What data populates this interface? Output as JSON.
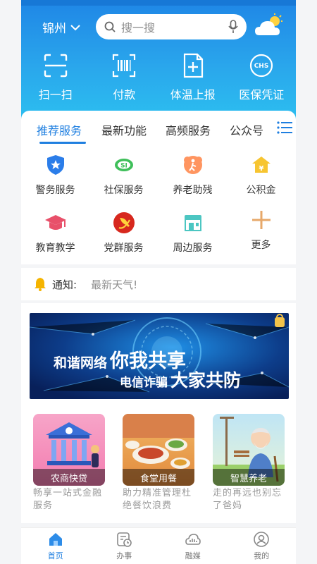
{
  "header": {
    "city": "锦州",
    "search_placeholder": "搜一搜"
  },
  "quick_actions": [
    {
      "label": "扫一扫",
      "icon": "scan-icon"
    },
    {
      "label": "付款",
      "icon": "barcode-icon"
    },
    {
      "label": "体温上报",
      "icon": "health-report-icon"
    },
    {
      "label": "医保凭证",
      "icon": "chs-insurance-icon"
    }
  ],
  "tabs": [
    "推荐服务",
    "最新功能",
    "高频服务",
    "公众号"
  ],
  "services": [
    {
      "label": "警务服务",
      "icon": "police-shield-icon"
    },
    {
      "label": "社保服务",
      "icon": "social-security-icon"
    },
    {
      "label": "养老助残",
      "icon": "elder-care-icon"
    },
    {
      "label": "公积金",
      "icon": "housing-fund-icon"
    },
    {
      "label": "教育教学",
      "icon": "graduation-cap-icon"
    },
    {
      "label": "党群服务",
      "icon": "party-emblem-icon"
    },
    {
      "label": "周边服务",
      "icon": "shop-icon"
    },
    {
      "label": "更多",
      "icon": "plus-icon"
    }
  ],
  "notice": {
    "label": "通知:",
    "message": "最新天气!"
  },
  "banner": {
    "line1": "和谐网络",
    "line1b": "你我共享",
    "line2": "电信诈骗",
    "line2b": "大家共防"
  },
  "features": [
    {
      "title": "农商快贷",
      "desc": "畅享一站式金融服务"
    },
    {
      "title": "食堂用餐",
      "desc": "助力精准管理杜绝餐饮浪费"
    },
    {
      "title": "智慧养老",
      "desc": "走的再远也别忘了爸妈"
    }
  ],
  "bottom_nav": [
    {
      "label": "首页",
      "icon": "home-icon",
      "active": true
    },
    {
      "label": "办事",
      "icon": "tasks-icon",
      "active": false
    },
    {
      "label": "融媒",
      "icon": "media-icon",
      "active": false
    },
    {
      "label": "我的",
      "icon": "profile-icon",
      "active": false
    }
  ],
  "colors": {
    "primary": "#1f7fe0",
    "header_top": "#1f86e6",
    "header_bottom": "#2cc0f0"
  }
}
